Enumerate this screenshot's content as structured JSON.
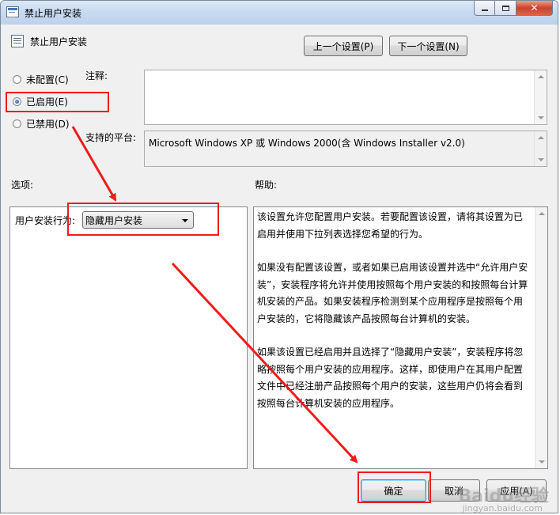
{
  "window": {
    "title": "禁止用户安装",
    "controls": {
      "minimize": "minimize-icon",
      "maximize": "maximize-icon",
      "close": "close-icon"
    }
  },
  "header": {
    "policy_name": "禁止用户安装",
    "prev_button": "上一个设置(P)",
    "next_button": "下一个设置(N)"
  },
  "state": {
    "options": [
      {
        "label": "未配置(C)",
        "checked": false
      },
      {
        "label": "已启用(E)",
        "checked": true
      },
      {
        "label": "已禁用(D)",
        "checked": false
      }
    ]
  },
  "comment": {
    "label": "注释:",
    "value": ""
  },
  "platform": {
    "label": "支持的平台:",
    "value": "Microsoft Windows XP 或 Windows 2000(含 Windows Installer v2.0)"
  },
  "options_section": {
    "label": "选项:",
    "install_behavior_label": "用户安装行为:",
    "install_behavior_value": "隐藏用户安装"
  },
  "help_section": {
    "label": "帮助:",
    "paragraphs": [
      "该设置允许您配置用户安装。若要配置该设置，请将其设置为已启用并使用下拉列表选择您希望的行为。",
      "如果没有配置该设置，或者如果已启用该设置并选中“允许用户安装”，安装程序将允许并使用按照每个用户安装的和按照每台计算机安装的产品。如果安装程序检测到某个应用程序是按照每个用户安装的，它将隐藏该产品按照每台计算机的安装。",
      "如果该设置已经启用并且选择了“隐藏用户安装”，安装程序将忽略按照每个用户安装的应用程序。这样，即使用户在其用户配置文件中已经注册产品按照每个用户的安装，这些用户仍将会看到按照每台计算机安装的应用程序。"
    ]
  },
  "footer": {
    "ok_button": "确定",
    "cancel_button": "取消",
    "apply_button": "应用(A)"
  },
  "watermark": {
    "brand": "Baidu经验",
    "url": "jingyan.baidu.com"
  },
  "colors": {
    "annotation": "#ee1c1c",
    "titlebar": "#c7daf0",
    "default_button": "#3c7fb1"
  }
}
